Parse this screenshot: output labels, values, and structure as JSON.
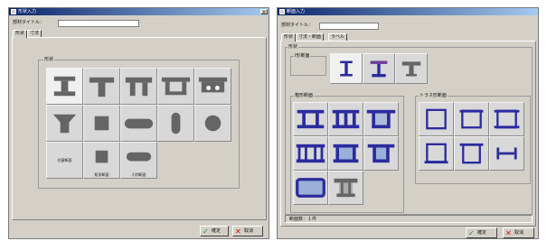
{
  "colors": {
    "steel_gray": "#656565",
    "steel_blue": "#2b2b9e",
    "titlebar": "#0a246a",
    "confirm_green": "#1c8a1c",
    "cancel_red": "#d01010"
  },
  "left": {
    "title": "形状入力",
    "close_glyph": "×",
    "name_label": "部材タイトル：",
    "tabs": [
      "形状",
      "寸法"
    ],
    "group_label": "形状",
    "cells": [
      {
        "name": "h-beam-icon",
        "icon": "h-beam",
        "label": ""
      },
      {
        "name": "t-beam-icon",
        "icon": "t-beam",
        "label": ""
      },
      {
        "name": "double-t-beam-icon",
        "icon": "double-t",
        "label": ""
      },
      {
        "name": "channel-section-icon",
        "icon": "channel",
        "label": ""
      },
      {
        "name": "deck-section-icon",
        "icon": "deck",
        "label": ""
      },
      {
        "name": "tapered-section-icon",
        "icon": "tapered",
        "label": ""
      },
      {
        "name": "square-icon",
        "icon": "square",
        "label": ""
      },
      {
        "name": "oval-bar-icon",
        "icon": "oval-h",
        "label": ""
      },
      {
        "name": "vertical-capsule-icon",
        "icon": "oval-v",
        "label": ""
      },
      {
        "name": "circle-icon",
        "icon": "circle",
        "label": ""
      },
      {
        "name": "arbitrary-section-cell",
        "icon": "none",
        "label": "任意断面"
      },
      {
        "name": "rectangle-cell",
        "icon": "rect-small",
        "label": "矩形断面"
      },
      {
        "name": "small-oval-cell",
        "icon": "oval-small",
        "label": "小判断面"
      }
    ],
    "ok_label": "確定",
    "cancel_label": "取消"
  },
  "right": {
    "title": "断面入力",
    "name_label": "部材タイトル：",
    "tabs": [
      "形状",
      "寸法・断面",
      "ラベル"
    ],
    "group_label": "形状",
    "i_group_label": "I形断面",
    "box_group_label": "箱形断面",
    "truss_group_label": "トラス形断面",
    "status_text": "断面数：１件",
    "ok_label": "確定",
    "cancel_label": "取消",
    "i_cells": [
      {
        "name": "i-section-icon",
        "icon": "i-thin"
      },
      {
        "name": "i-section-wide-icon",
        "icon": "i-purple"
      },
      {
        "name": "t-section-icon",
        "icon": "t-gray"
      }
    ],
    "box_cells": [
      {
        "name": "box-two-web-icon",
        "icon": "box-2"
      },
      {
        "name": "box-three-web-icon",
        "icon": "box-3"
      },
      {
        "name": "box-cantilever-icon",
        "icon": "box-cant"
      },
      {
        "name": "box-four-web-icon",
        "icon": "box-4"
      },
      {
        "name": "box-filled-icon",
        "icon": "box-dot"
      },
      {
        "name": "box-filled-cantilever-icon",
        "icon": "box-dot-cant"
      },
      {
        "name": "box-round-filled-icon",
        "icon": "box-round"
      },
      {
        "name": "pedestal-section-icon",
        "icon": "pedestal"
      }
    ],
    "truss_cells": [
      {
        "name": "truss-square-icon",
        "icon": "sq"
      },
      {
        "name": "truss-square-top-icon",
        "icon": "sq-top"
      },
      {
        "name": "truss-square-flange-icon",
        "icon": "sq-flange"
      },
      {
        "name": "truss-square-bottom-icon",
        "icon": "sq-bottom"
      },
      {
        "name": "truss-square-open-icon",
        "icon": "sq-open"
      },
      {
        "name": "truss-h-link-icon",
        "icon": "h-link"
      }
    ]
  }
}
